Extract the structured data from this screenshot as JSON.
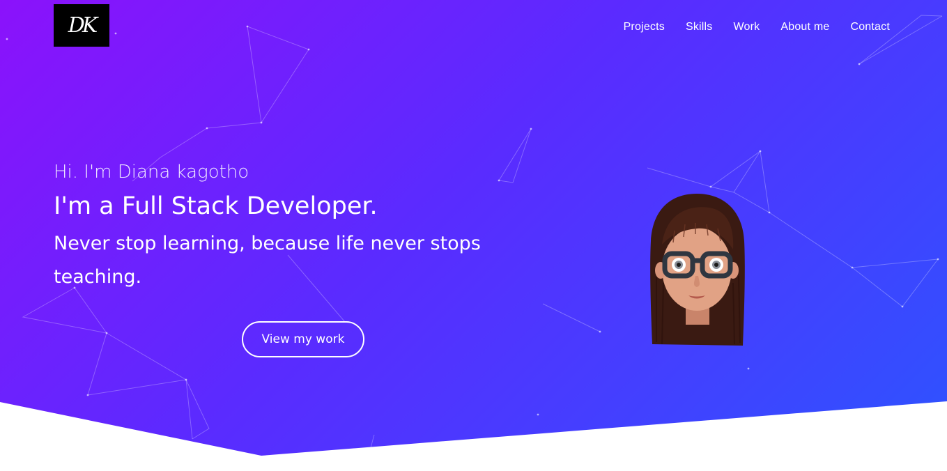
{
  "logo": {
    "text": "DK"
  },
  "nav": {
    "items": [
      "Projects",
      "Skills",
      "Work",
      "About me",
      "Contact"
    ]
  },
  "hero": {
    "greeting": "Hi. I'm Diana kagotho",
    "title": "I'm a Full Stack Developer.",
    "tagline": "Never stop learning, because life never stops teaching.",
    "cta_label": "View my work"
  },
  "colors": {
    "gradient_start": "#8b12fb",
    "gradient_end": "#2d54ff",
    "text": "#ffffff"
  },
  "icons": {
    "avatar": "memoji-avatar"
  }
}
